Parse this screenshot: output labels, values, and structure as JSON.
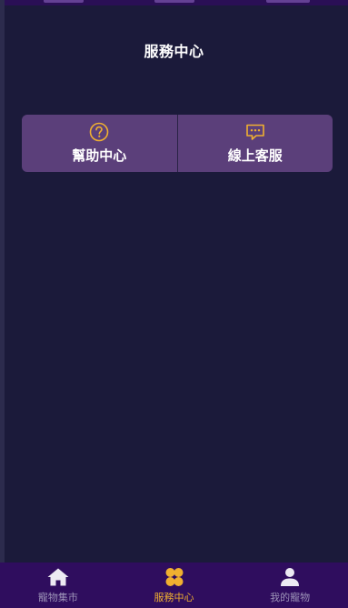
{
  "page": {
    "title": "服務中心"
  },
  "services": [
    {
      "label": "幫助中心",
      "icon": "help-circle-icon"
    },
    {
      "label": "線上客服",
      "icon": "chat-bubble-icon"
    }
  ],
  "bottom_nav": [
    {
      "label": "寵物集市",
      "icon": "home-icon",
      "active": false
    },
    {
      "label": "服務中心",
      "icon": "clover-icon",
      "active": true
    },
    {
      "label": "我的寵物",
      "icon": "user-icon",
      "active": false
    }
  ],
  "colors": {
    "background": "#1b1a3a",
    "card": "#5b3f7a",
    "accent": "#f0b030",
    "nav_background": "#2f0d5e",
    "nav_inactive": "#9d93b8"
  }
}
